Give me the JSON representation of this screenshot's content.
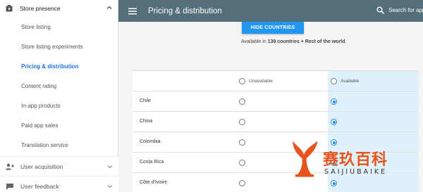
{
  "sidebar": {
    "header": "Store presence",
    "items": [
      {
        "label": "Store listing",
        "active": false
      },
      {
        "label": "Store listing experiments",
        "active": false
      },
      {
        "label": "Pricing & distribution",
        "active": true
      },
      {
        "label": "Content rating",
        "active": false
      },
      {
        "label": "In-app products",
        "active": false
      },
      {
        "label": "Paid app sales",
        "active": false
      },
      {
        "label": "Translation service",
        "active": false
      }
    ],
    "sections": [
      {
        "label": "User acquisition",
        "icon": "person-add-icon"
      },
      {
        "label": "User feedback",
        "icon": "feedback-icon"
      }
    ]
  },
  "topbar": {
    "title": "Pricing & distribution",
    "search_placeholder": "Search for app"
  },
  "main": {
    "hide_button": "HIDE COUNTRIES",
    "avail_prefix": "Available in ",
    "avail_bold": "139 countries + Rest of the world",
    "avail_suffix": ".",
    "header_unavailable": "Unavailable",
    "header_available": "Available",
    "rows": [
      {
        "country": "Chile",
        "selected": "available"
      },
      {
        "country": "China",
        "selected": "available"
      },
      {
        "country": "Colombia",
        "selected": "available"
      },
      {
        "country": "Costa Rica",
        "selected": "available"
      },
      {
        "country": "Côte d'Ivoire",
        "selected": "available"
      }
    ]
  },
  "watermark": {
    "main": "赛玖百科",
    "sub": "SAIJIUBAIKE"
  },
  "colors": {
    "topbar": "#546e7a",
    "accent": "#2196f3",
    "highlight": "#dff1fb",
    "watermark": "#e8541e"
  }
}
